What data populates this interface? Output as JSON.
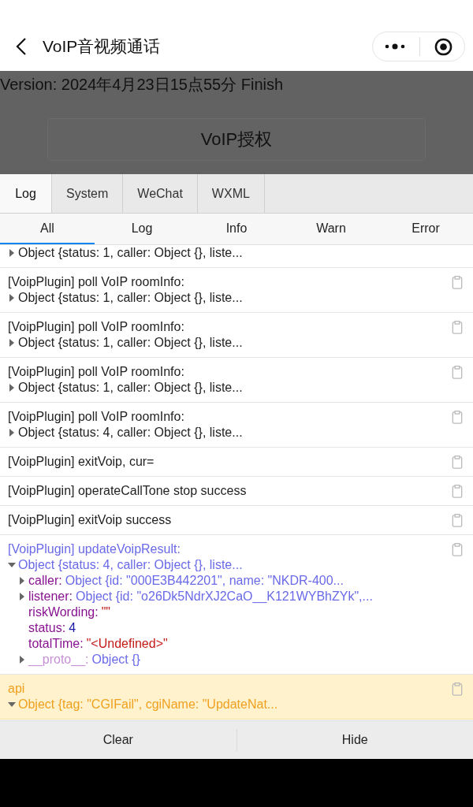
{
  "nav": {
    "title": "VoIP音视频通话"
  },
  "page": {
    "version": "Version: 2024年4月23日15点55分 Finish",
    "button": "VoIP授权"
  },
  "tabs": [
    {
      "label": "Log",
      "selected": true
    },
    {
      "label": "System",
      "selected": false
    },
    {
      "label": "WeChat",
      "selected": false
    },
    {
      "label": "WXML",
      "selected": false
    }
  ],
  "filters": [
    {
      "label": "All",
      "selected": true
    },
    {
      "label": "Log",
      "selected": false
    },
    {
      "label": "Info",
      "selected": false
    },
    {
      "label": "Warn",
      "selected": false
    },
    {
      "label": "Error",
      "selected": false
    }
  ],
  "entries": [
    {
      "kind": "log",
      "object": {
        "summary": "Object {status: 1, caller: Object {}, liste...",
        "expanded": false
      }
    },
    {
      "kind": "log",
      "message": "[VoipPlugin] poll VoIP roomInfo:",
      "object": {
        "summary": "Object {status: 1, caller: Object {}, liste...",
        "expanded": false
      }
    },
    {
      "kind": "log",
      "message": "[VoipPlugin] poll VoIP roomInfo:",
      "object": {
        "summary": "Object {status: 1, caller: Object {}, liste...",
        "expanded": false
      }
    },
    {
      "kind": "log",
      "message": "[VoipPlugin] poll VoIP roomInfo:",
      "object": {
        "summary": "Object {status: 1, caller: Object {}, liste...",
        "expanded": false
      }
    },
    {
      "kind": "log",
      "message": "[VoipPlugin] poll VoIP roomInfo:",
      "object": {
        "summary": "Object {status: 4, caller: Object {}, liste...",
        "expanded": false
      }
    },
    {
      "kind": "log",
      "message": "[VoipPlugin] exitVoip, cur="
    },
    {
      "kind": "log",
      "message": "[VoipPlugin] operateCallTone stop success"
    },
    {
      "kind": "log",
      "message": "[VoipPlugin] exitVoip success"
    },
    {
      "kind": "info",
      "message": "[VoipPlugin] updateVoipResult:",
      "object": {
        "summary": "Object {status: 4, caller: Object {}, liste...",
        "expanded": true,
        "children": [
          {
            "key": "caller:",
            "kind": "object",
            "value": "Object {id: \"000E3B442201\", name: \"NKDR-400...",
            "expanded": false
          },
          {
            "key": "listener:",
            "kind": "object",
            "value": "Object {id: \"o26Dk5NdrXJ2CaO__K121WYBhZYk\",...",
            "expanded": false
          },
          {
            "key": "riskWording:",
            "kind": "string",
            "value": "\"\""
          },
          {
            "key": "status:",
            "kind": "number",
            "value": "4"
          },
          {
            "key": "totalTime:",
            "kind": "string",
            "value": "\"<Undefined>\""
          },
          {
            "key": "__proto__:",
            "kind": "proto",
            "value": "Object {}",
            "expanded": false
          }
        ]
      }
    },
    {
      "kind": "warn",
      "message": "api",
      "object": {
        "summary": "Object {tag: \"CGIFail\", cgiName: \"UpdateNat...",
        "expanded": true
      }
    }
  ],
  "footer": [
    "Clear",
    "Hide"
  ]
}
